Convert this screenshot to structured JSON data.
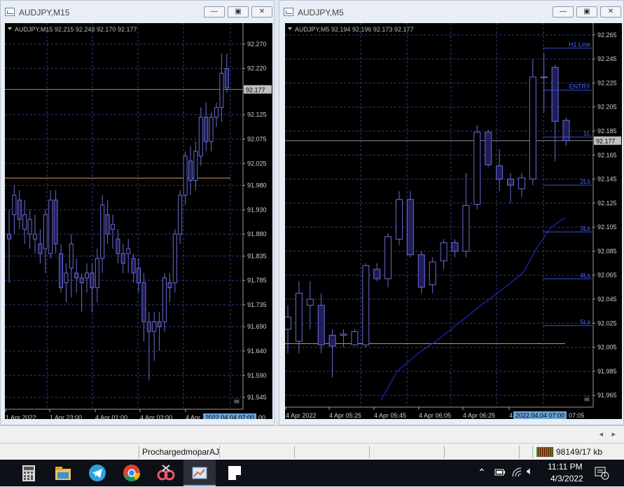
{
  "left_window": {
    "title": "AUDJPY,M15",
    "header": "AUDJPY,M15  92.215 92.248 92.170 92.177",
    "price_labels": [
      "92.270",
      "92.220",
      "92.125",
      "92.075",
      "92.025",
      "91.980",
      "91.930",
      "91.880",
      "91.835",
      "91.785",
      "91.735",
      "91.690",
      "91.640",
      "91.590",
      "91.545"
    ],
    "current_price": "92.177",
    "time_labels": [
      "1 Apr 2022",
      "1 Apr 23:00",
      "4 Apr 01:00",
      "4 Apr 03:00",
      "4 Apr"
    ],
    "time_highlight": "2022.04.04 07:00",
    "time_end": "00"
  },
  "right_window": {
    "title": "AUDJPY,M5",
    "header": "AUDJPY,M5  92.194 92.196 92.173 92.177",
    "price_labels": [
      "92.265",
      "92.245",
      "92.225",
      "92.205",
      "92.185",
      "92.165",
      "92.145",
      "92.125",
      "92.105",
      "92.085",
      "92.065",
      "92.045",
      "92.025",
      "92.005",
      "91.985",
      "91.965"
    ],
    "current_price": "92.177",
    "time_labels": [
      "4 Apr 2022",
      "4 Apr 05:25",
      "4 Apr 05:45",
      "4 Apr 06:05",
      "4 Apr 06:25",
      "4"
    ],
    "time_highlight": "2022.04.04 07:00",
    "time_end": "07:05",
    "level_labels": [
      "H1 Line",
      "ENTRY",
      "1L",
      "2Ls",
      "3Ls",
      "4Ls",
      "5Ls"
    ]
  },
  "status": {
    "profile": "ProchargedmoparAJ",
    "traffic": "98149/17 kb"
  },
  "taskbar": {
    "time": "11:11 PM",
    "date": "4/3/2022",
    "notif_count": "1"
  },
  "chart_data": [
    {
      "type": "candlestick",
      "title": "AUDJPY,M15",
      "ylim": [
        91.535,
        92.29
      ],
      "horizontal_line": 91.995,
      "current_price": 92.177,
      "candles": [
        {
          "o": 91.88,
          "h": 91.93,
          "l": 91.78,
          "c": 91.87
        },
        {
          "o": 91.92,
          "h": 91.98,
          "l": 91.88,
          "c": 91.96
        },
        {
          "o": 91.95,
          "h": 91.97,
          "l": 91.89,
          "c": 91.91
        },
        {
          "o": 91.89,
          "h": 91.95,
          "l": 91.86,
          "c": 91.92
        },
        {
          "o": 91.88,
          "h": 91.93,
          "l": 91.85,
          "c": 91.91
        },
        {
          "o": 91.87,
          "h": 91.92,
          "l": 91.84,
          "c": 91.88
        },
        {
          "o": 91.86,
          "h": 91.89,
          "l": 91.82,
          "c": 91.84
        },
        {
          "o": 91.85,
          "h": 91.93,
          "l": 91.8,
          "c": 91.92
        },
        {
          "o": 91.84,
          "h": 91.97,
          "l": 91.83,
          "c": 91.95
        },
        {
          "o": 91.95,
          "h": 91.97,
          "l": 91.84,
          "c": 91.86
        },
        {
          "o": 91.84,
          "h": 91.86,
          "l": 91.76,
          "c": 91.77
        },
        {
          "o": 91.78,
          "h": 91.82,
          "l": 91.74,
          "c": 91.8
        },
        {
          "o": 91.81,
          "h": 91.88,
          "l": 91.75,
          "c": 91.86
        },
        {
          "o": 91.8,
          "h": 91.83,
          "l": 91.76,
          "c": 91.79
        },
        {
          "o": 91.79,
          "h": 91.8,
          "l": 91.72,
          "c": 91.78
        },
        {
          "o": 91.79,
          "h": 91.82,
          "l": 91.76,
          "c": 91.8
        },
        {
          "o": 91.8,
          "h": 91.82,
          "l": 91.72,
          "c": 91.77
        },
        {
          "o": 91.77,
          "h": 91.85,
          "l": 91.74,
          "c": 91.83
        },
        {
          "o": 91.83,
          "h": 91.96,
          "l": 91.8,
          "c": 91.94
        },
        {
          "o": 91.92,
          "h": 91.95,
          "l": 91.86,
          "c": 91.88
        },
        {
          "o": 91.89,
          "h": 91.92,
          "l": 91.85,
          "c": 91.9
        },
        {
          "o": 91.87,
          "h": 91.89,
          "l": 91.82,
          "c": 91.84
        },
        {
          "o": 91.84,
          "h": 91.86,
          "l": 91.8,
          "c": 91.82
        },
        {
          "o": 91.84,
          "h": 91.87,
          "l": 91.8,
          "c": 91.85
        },
        {
          "o": 91.83,
          "h": 91.84,
          "l": 91.78,
          "c": 91.8
        },
        {
          "o": 91.81,
          "h": 91.83,
          "l": 91.76,
          "c": 91.78
        },
        {
          "o": 91.78,
          "h": 91.8,
          "l": 91.66,
          "c": 91.7
        },
        {
          "o": 91.7,
          "h": 91.72,
          "l": 91.58,
          "c": 91.68
        },
        {
          "o": 91.68,
          "h": 91.72,
          "l": 91.62,
          "c": 91.7
        },
        {
          "o": 91.7,
          "h": 91.72,
          "l": 91.64,
          "c": 91.69
        },
        {
          "o": 91.7,
          "h": 91.8,
          "l": 91.68,
          "c": 91.79
        },
        {
          "o": 91.78,
          "h": 91.8,
          "l": 91.74,
          "c": 91.77
        },
        {
          "o": 91.78,
          "h": 91.89,
          "l": 91.76,
          "c": 91.88
        },
        {
          "o": 91.88,
          "h": 91.97,
          "l": 91.86,
          "c": 91.96
        },
        {
          "o": 91.96,
          "h": 92.05,
          "l": 91.94,
          "c": 92.04
        },
        {
          "o": 92.03,
          "h": 92.06,
          "l": 91.96,
          "c": 91.99
        },
        {
          "o": 91.99,
          "h": 92.07,
          "l": 91.97,
          "c": 92.05
        },
        {
          "o": 92.04,
          "h": 92.14,
          "l": 92.02,
          "c": 92.12
        },
        {
          "o": 92.12,
          "h": 92.15,
          "l": 92.05,
          "c": 92.07
        },
        {
          "o": 92.07,
          "h": 92.13,
          "l": 92.05,
          "c": 92.12
        },
        {
          "o": 92.12,
          "h": 92.15,
          "l": 92.1,
          "c": 92.14
        },
        {
          "o": 92.14,
          "h": 92.25,
          "l": 92.11,
          "c": 92.21
        },
        {
          "o": 92.22,
          "h": 92.25,
          "l": 92.17,
          "c": 92.18
        }
      ]
    },
    {
      "type": "candlestick",
      "title": "AUDJPY,M5",
      "ylim": [
        91.961,
        92.269
      ],
      "horizontal_line": 92.008,
      "current_price": 92.177,
      "levels": {
        "H1 Line": 92.254,
        "ENTRY": 92.219,
        "1L": 92.18,
        "2Ls": 92.14,
        "3Ls": 92.101,
        "4Ls": 92.062,
        "5Ls": 92.023
      },
      "candles": [
        {
          "o": 92.02,
          "h": 92.04,
          "l": 92.0,
          "c": 92.03
        },
        {
          "o": 92.01,
          "h": 92.06,
          "l": 92.0,
          "c": 92.05
        },
        {
          "o": 92.04,
          "h": 92.06,
          "l": 92.02,
          "c": 92.045
        },
        {
          "o": 92.04,
          "h": 92.05,
          "l": 92.0,
          "c": 92.007
        },
        {
          "o": 92.015,
          "h": 92.02,
          "l": 91.98,
          "c": 92.006
        },
        {
          "o": 92.015,
          "h": 92.02,
          "l": 92.005,
          "c": 92.016
        },
        {
          "o": 92.007,
          "h": 92.02,
          "l": 92.006,
          "c": 92.018
        },
        {
          "o": 92.007,
          "h": 92.075,
          "l": 92.005,
          "c": 92.073
        },
        {
          "o": 92.07,
          "h": 92.075,
          "l": 92.06,
          "c": 92.062
        },
        {
          "o": 92.062,
          "h": 92.1,
          "l": 92.055,
          "c": 92.097
        },
        {
          "o": 92.095,
          "h": 92.135,
          "l": 92.09,
          "c": 92.128
        },
        {
          "o": 92.128,
          "h": 92.135,
          "l": 92.08,
          "c": 92.082
        },
        {
          "o": 92.082,
          "h": 92.085,
          "l": 92.05,
          "c": 92.055
        },
        {
          "o": 92.057,
          "h": 92.08,
          "l": 92.05,
          "c": 92.076
        },
        {
          "o": 92.077,
          "h": 92.095,
          "l": 92.07,
          "c": 92.092
        },
        {
          "o": 92.092,
          "h": 92.095,
          "l": 92.08,
          "c": 92.085
        },
        {
          "o": 92.085,
          "h": 92.15,
          "l": 92.08,
          "c": 92.123
        },
        {
          "o": 92.124,
          "h": 92.19,
          "l": 92.12,
          "c": 92.184
        },
        {
          "o": 92.184,
          "h": 92.186,
          "l": 92.155,
          "c": 92.157
        },
        {
          "o": 92.156,
          "h": 92.17,
          "l": 92.135,
          "c": 92.145
        },
        {
          "o": 92.145,
          "h": 92.15,
          "l": 92.125,
          "c": 92.14
        },
        {
          "o": 92.137,
          "h": 92.15,
          "l": 92.13,
          "c": 92.146
        },
        {
          "o": 92.145,
          "h": 92.245,
          "l": 92.14,
          "c": 92.23
        },
        {
          "o": 92.23,
          "h": 92.25,
          "l": 92.2,
          "c": 92.23
        },
        {
          "o": 92.238,
          "h": 92.24,
          "l": 92.16,
          "c": 92.193
        },
        {
          "o": 92.194,
          "h": 92.196,
          "l": 92.173,
          "c": 92.177
        }
      ]
    }
  ],
  "colors": {
    "bull_body": "#000000",
    "bear_body": "#1e1e5a",
    "candle_edge": "#6b6bd6",
    "grid": "#2f3f7f",
    "orange_line": "#e39a5a",
    "ma_line": "#1d24b4"
  }
}
